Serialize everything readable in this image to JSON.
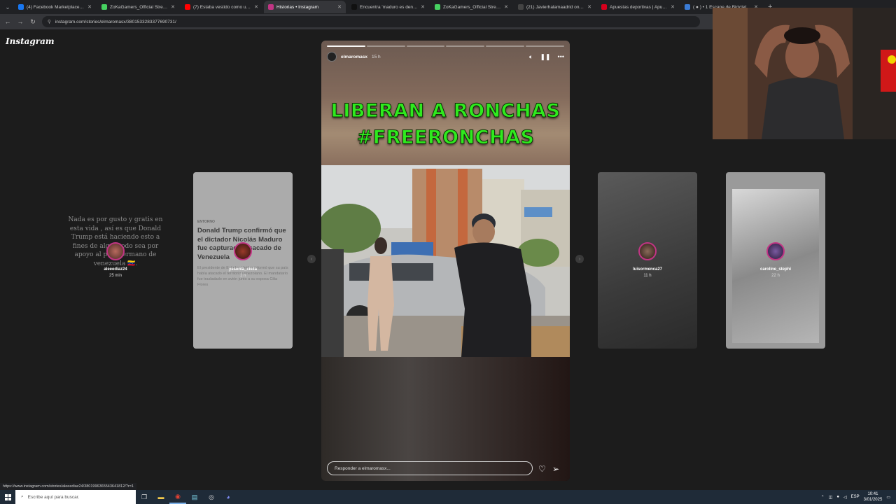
{
  "browser": {
    "tabs": [
      {
        "title": "(4) Facebook Marketplace | Face",
        "color": "#1877f2"
      },
      {
        "title": "ZoKaGamers_Official Stream - V",
        "color": "#46d160"
      },
      {
        "title": "(7) Estaba vestido como una ab",
        "color": "#ff0000"
      },
      {
        "title": "Historias • Instagram",
        "color": "#c13584",
        "active": true
      },
      {
        "title": "Encuentra 'maduro es denuncia",
        "color": "#111111"
      },
      {
        "title": "ZoKaGamers_Official Stream - V",
        "color": "#46d160"
      },
      {
        "title": "(21) Javierhalamaadrid on X: 'Im",
        "color": "#444444"
      },
      {
        "title": "Apuestas deportivas | Apuesta",
        "color": "#d6001c"
      },
      {
        "title": "( ● ) • 1 Escape de Bicicleta de",
        "color": "#3a7bd5"
      }
    ],
    "new_tab": "+",
    "url": "instagram.com/stories/elmaromasx/3801533283377690731/"
  },
  "instagram": {
    "logo": "Instagram",
    "text_card": {
      "text": "Nada es por gusto y gratis en esta vida , así es que Donald Trump está haciendo esto a fines de algo? todo sea por apoyo al país hermano de venezuela 🇻🇪.",
      "user": "aleeediaz24",
      "time": "25 min"
    },
    "news_card": {
      "source": "ENTORNO",
      "headline": "Donald Trump confirmó que el dictador Nicolás Maduro fue capturado y sacado de Venezuela",
      "body": "El presidente de Estados Unidos informó que su país había atacado el territorio venezolano. El mandatario fue trasladado en avión junto a su esposa Cilia Flores",
      "user": "yesenia_cieza",
      "time": "1 h"
    },
    "story": {
      "user": "elmaromasx",
      "time": "15 h",
      "headline_line1": "LIBERAN A RONCHAS",
      "headline_line2": "#FREERONCHAS",
      "reply_placeholder": "Responder a elmaromasx...",
      "progress_total": 6,
      "progress_done": 1
    },
    "right_card_1": {
      "user": "luisormenca27",
      "time": "11 h"
    },
    "right_card_2": {
      "user": "caroline_stephi",
      "time": "22 h"
    }
  },
  "status_bar": {
    "url": "https://www.instagram.com/stories/aleeediaz24/3801996365543641812/?r=1"
  },
  "taskbar": {
    "search_placeholder": "Escribe aquí para buscar.",
    "language": "ESP",
    "time": "10:41",
    "date": "3/01/2025"
  }
}
